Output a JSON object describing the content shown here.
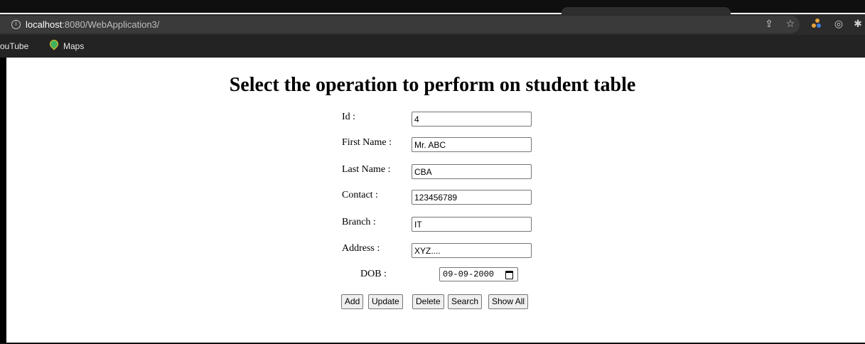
{
  "browser": {
    "url_host": "localhost",
    "url_path": ":8080/WebApplication3/",
    "bookmarks": [
      "ouTube",
      "Maps"
    ]
  },
  "page": {
    "title": "Select the operation to perform on student table"
  },
  "form": {
    "id_label": "Id :",
    "id_value": "4",
    "first_name_label": "First Name :",
    "first_name_value": "Mr. ABC",
    "last_name_label": "Last Name :",
    "last_name_value": "CBA",
    "contact_label": "Contact :",
    "contact_value": "123456789",
    "branch_label": "Branch :",
    "branch_value": "IT",
    "address_label": "Address :",
    "address_value": "XYZ....",
    "dob_label": "DOB :",
    "dob_value": "09-09-2000"
  },
  "buttons": {
    "add": "Add",
    "update": "Update",
    "delete": "Delete",
    "search": "Search",
    "show_all": "Show All"
  },
  "icons": [
    "info-icon",
    "share-icon",
    "star-icon",
    "extension-icon",
    "reading-mode-icon",
    "puzzle-icon",
    "map-pin-icon",
    "calendar-icon"
  ]
}
